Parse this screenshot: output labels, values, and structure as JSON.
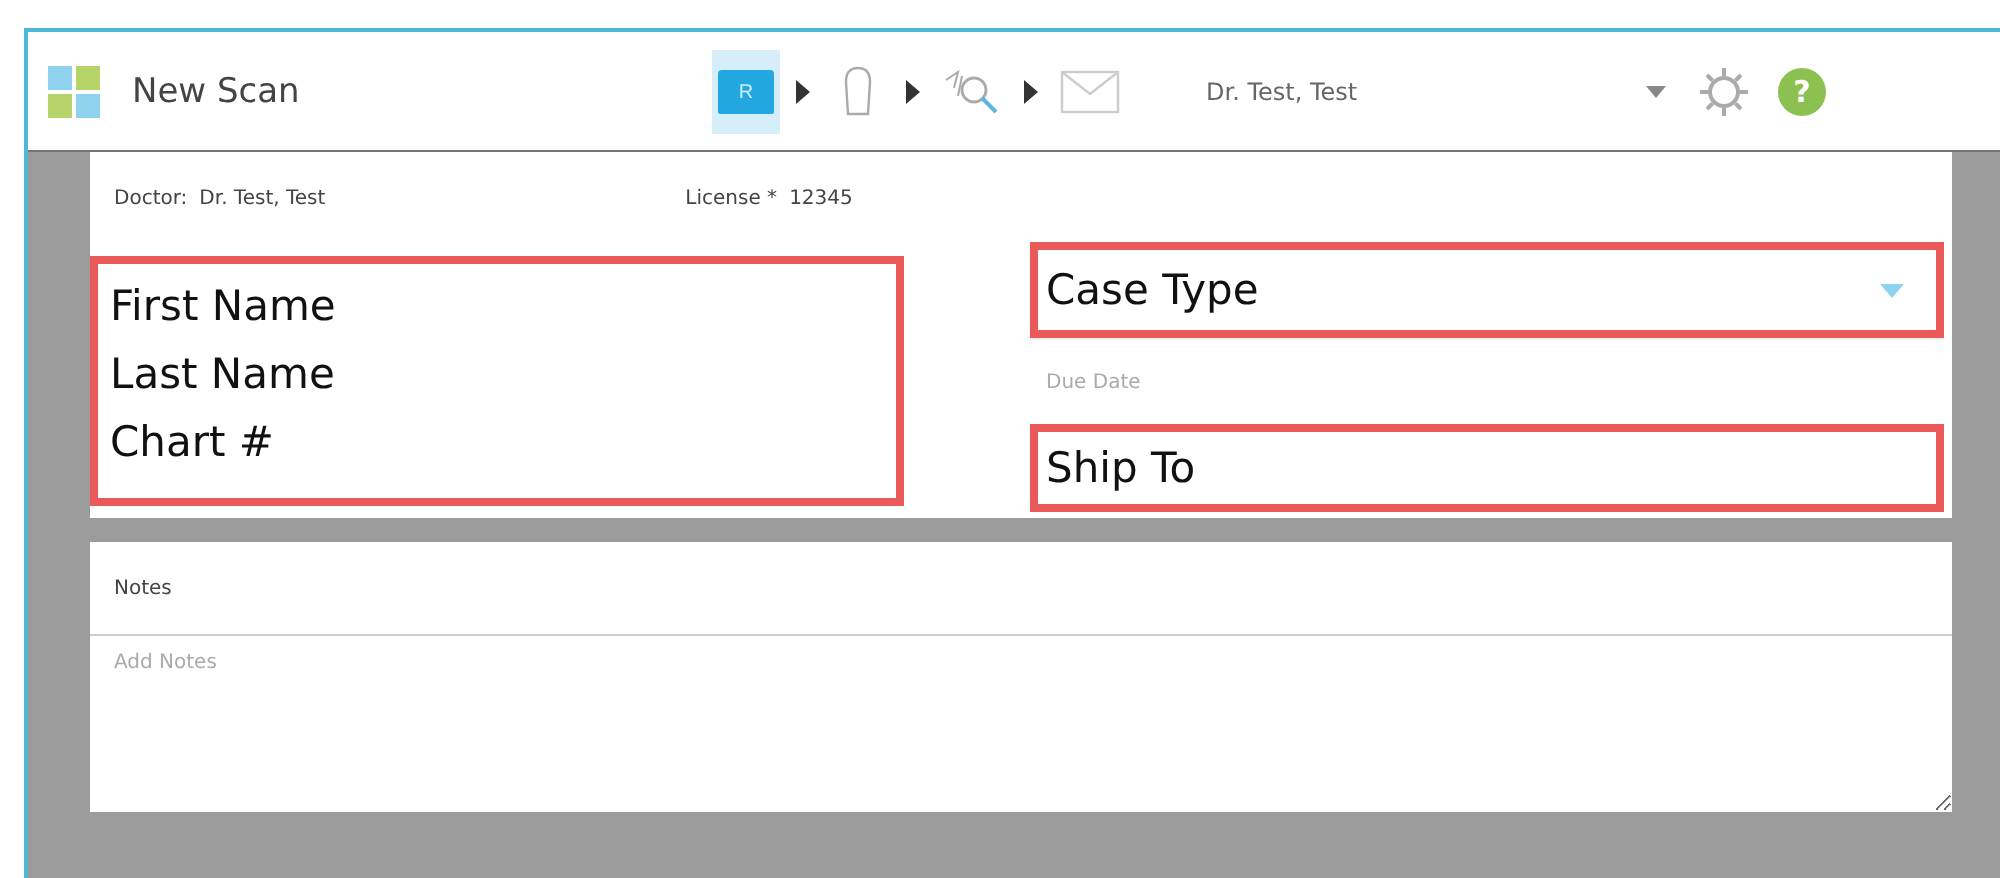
{
  "window": {
    "title": "New Scan"
  },
  "steps": [
    {
      "kind": "folder",
      "label": "R",
      "selected": true
    },
    {
      "kind": "scan",
      "selected": false
    },
    {
      "kind": "review",
      "selected": false
    },
    {
      "kind": "send",
      "selected": false
    }
  ],
  "user": {
    "name": "Dr. Test, Test"
  },
  "help": {
    "glyph": "?"
  },
  "doctor": {
    "label": "Doctor:",
    "value": "Dr. Test, Test"
  },
  "license": {
    "label": "License *",
    "value": "12345"
  },
  "patient_callout": {
    "labels": [
      "First Name",
      "Last Name",
      "Chart #"
    ]
  },
  "case_type": {
    "label": "Case Type"
  },
  "due_date": {
    "placeholder": "Due Date"
  },
  "ship_to": {
    "label": "Ship To"
  },
  "notes": {
    "title": "Notes",
    "placeholder": "Add Notes"
  }
}
